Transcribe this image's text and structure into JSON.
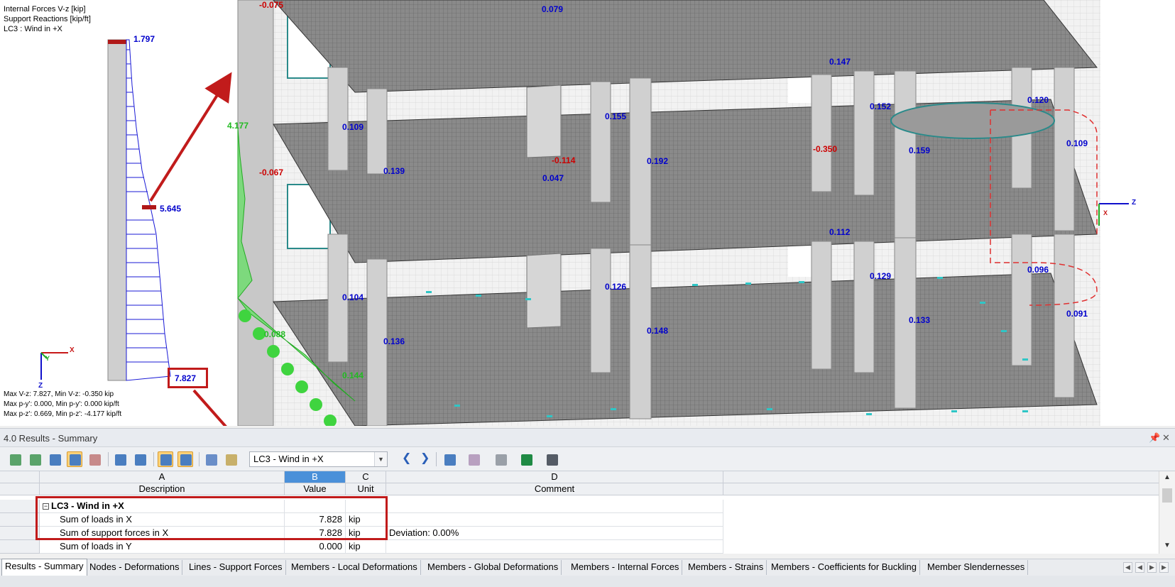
{
  "viewport": {
    "info_lines": [
      "Internal Forces V-z [kip]",
      "Support Reactions [kip/ft]",
      "LC3 : Wind in +X"
    ],
    "footer_lines": [
      "Max V-z: 7.827, Min V-z: -0.350 kip",
      "Max p-y': 0.000, Min p-y': 0.000 kip/ft",
      "Max p-z': 0.669, Min p-z': -4.177 kip/ft"
    ],
    "member_labels": {
      "top": "1.797",
      "middle": "5.645",
      "bottom": "7.827"
    },
    "axis_labels": {
      "x": "X",
      "y": "Y",
      "z": "Z"
    },
    "model_axis_labels": {
      "z": "Z",
      "x": "X"
    },
    "blue_values": [
      "0.079",
      "0.147",
      "0.109",
      "0.155",
      "0.152",
      "0.120",
      "0.192",
      "0.139",
      "0.047",
      "0.159",
      "0.109",
      "0.112",
      "0.104",
      "0.126",
      "0.129",
      "0.096",
      "0.136",
      "0.148",
      "0.133",
      "0.091"
    ],
    "red_values": [
      "-0.075",
      "-0.114",
      "-0.350",
      "-0.067"
    ],
    "green_values": [
      "4.177",
      "0.088",
      "0.144"
    ],
    "colors": {
      "member_diagram": "#1a1ad6",
      "annotation": "#c11b1b",
      "support": "#22cc22",
      "surface": "#7a7a7a"
    }
  },
  "panel": {
    "title": "4.0 Results - Summary",
    "pin_icon": "pin-icon",
    "close_icon": "close-icon"
  },
  "toolbar": {
    "load_case": "LC3 - Wind in +X",
    "prev_icon": "arrow-left-icon",
    "next_icon": "arrow-right-icon"
  },
  "table": {
    "columns": [
      {
        "letter": "A",
        "title": "Description"
      },
      {
        "letter": "B",
        "title": "Value"
      },
      {
        "letter": "C",
        "title": "Unit"
      },
      {
        "letter": "D",
        "title": "Comment"
      }
    ],
    "group": "LC3 - Wind in +X",
    "rows": [
      {
        "description": "Sum of loads in X",
        "value": "7.828",
        "unit": "kip",
        "comment": ""
      },
      {
        "description": "Sum of support forces in X",
        "value": "7.828",
        "unit": "kip",
        "comment": "Deviation:  0.00%"
      },
      {
        "description": "Sum of loads in Y",
        "value": "0.000",
        "unit": "kip",
        "comment": ""
      }
    ]
  },
  "tabs": [
    "Results - Summary",
    "Nodes - Deformations",
    "Lines - Support Forces",
    "Members - Local Deformations",
    "Members - Global Deformations",
    "Members - Internal Forces",
    "Members - Strains",
    "Members - Coefficients for Buckling",
    "Member Slendernesses"
  ]
}
